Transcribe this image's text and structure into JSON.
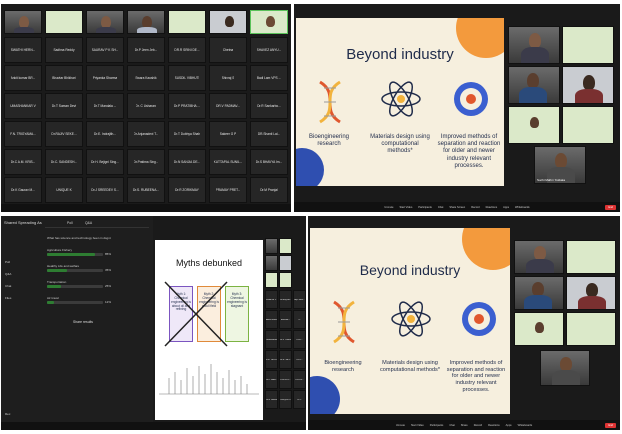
{
  "panel1": {
    "name_tiles": [
      [
        "SWATHI HERN...",
        "Sadhna Reddy",
        "SAURAV P K SH...",
        "Dr.P Jeen Jeb...",
        "DR.R SRINI DE...",
        "Chetna",
        "SHAVEZ ANYU..."
      ],
      [
        "Ankit kumar BR...",
        "Bhavtar Bhikhari",
        "Priyanka Sharma",
        "Swara Kaushik",
        "SUSDIL VIBHUTI",
        "Shivraj S",
        "Badi Lam VPS ..."
      ],
      [
        "UMASHANKAR V",
        "Dr.T Suman Devi",
        "Dr.T Mandala ...",
        "Dr. C Usharani",
        "Dr.P PRATIBHA ...",
        "DR.V PADMAV...",
        "Dr.R Sankarbo..."
      ],
      [
        "F.N. TRIGYAMA...",
        "Dr.RAJIV SEKE...",
        "Dr.E. Indrajith...",
        "Dr.Anjanadevi T...",
        "Dr.T Dubhya Shah",
        "Sakeer G P",
        "DR.Shanti Lal..."
      ],
      [
        "Dr.C A.M. KRIS...",
        "Dr.C. SANDESH...",
        "Dr.H. Bejigni Sing...",
        "Dr.Pratima Sing...",
        "Dr.N SANJIA DE...",
        "KUTTAPAL SUNIL...",
        "Dr.S BHAVYA Im..."
      ],
      [
        "Dr.K Gaurav M...",
        "UNIQUE K",
        "Dr.J SREEDEV S...",
        "Dr.S. RUBEENA...",
        "Dr.R ZORIKMAY",
        "PRAMAY PRET...",
        "Dr.M Pranjal"
      ]
    ]
  },
  "panel2": {
    "slide": {
      "title": "Beyond industry",
      "items": [
        {
          "caption": "Bioengineering research"
        },
        {
          "caption": "Materials design using computational methods*"
        },
        {
          "caption": "Improved methods of separation and reaction for older and newer industry relevant processes."
        }
      ]
    },
    "presenter_name": "Suchi Malhi / Kolkata",
    "toolbar": [
      "Unmute",
      "Start Video",
      "Participants",
      "Chat",
      "Share Screen",
      "Record",
      "Reactions",
      "Apps",
      "Whiteboards"
    ],
    "end_label": "End"
  },
  "panel3": {
    "sidebar": {
      "title": "Shared Spreading As",
      "tab1": "Poll",
      "tab2": "Q&A",
      "question": "What has science and technology been in dsgnt",
      "options": [
        {
          "label": "Agriculture Fishery",
          "value": 0.85,
          "pct": "85%"
        },
        {
          "label": "Healthy Life and welfare",
          "value": 0.35,
          "pct": "35%"
        },
        {
          "label": "Transportation",
          "value": 0.25,
          "pct": "25%"
        },
        {
          "label": "Air travel",
          "value": 0.12,
          "pct": "12%"
        }
      ],
      "share_label": "Share results",
      "left_labels": [
        "Poll",
        "Q&A",
        "Chat",
        "Files"
      ],
      "record_label": "Rec"
    },
    "slide": {
      "title": "Myths debunked",
      "boxes": [
        "Myth 1: Chemical engineering is about oil and refining",
        "Myth 2: Chemical engineering is a dull field",
        "Myth 3: Chemical engineering is stagnant"
      ]
    },
    "name_tiles": [
      [
        "SWATHI P S...",
        "Dr.Roy da...",
        "Biju Sam..."
      ],
      [
        "Ankit kumar...",
        "Bhavtar...",
        "Pl..."
      ],
      [
        "Umashankar...",
        "Dr.V Thana...",
        "Dr.R..."
      ],
      [
        "F.N. TRIGY...",
        "Dr.S. SBY...",
        "Dr.S..."
      ],
      [
        "Dr.C SAN...",
        "Dr.R ELY...",
        "Dr.PIN..."
      ],
      [
        "Dr.K Gaura...",
        "UNIQUE K",
        "Dr.J..."
      ]
    ]
  },
  "panel4": {
    "slide": {
      "title": "Beyond industry",
      "items": [
        {
          "caption": "Bioengineering research"
        },
        {
          "caption": "Materials design using computational methods*"
        },
        {
          "caption": "Improved methods of separation and reaction for older and newer industry relevant processes."
        }
      ]
    },
    "toolbar": [
      "Unmute",
      "Start Video",
      "Participants",
      "Chat",
      "Share",
      "Record",
      "Reactions",
      "Apps",
      "Whiteboards"
    ],
    "end_label": "End"
  }
}
